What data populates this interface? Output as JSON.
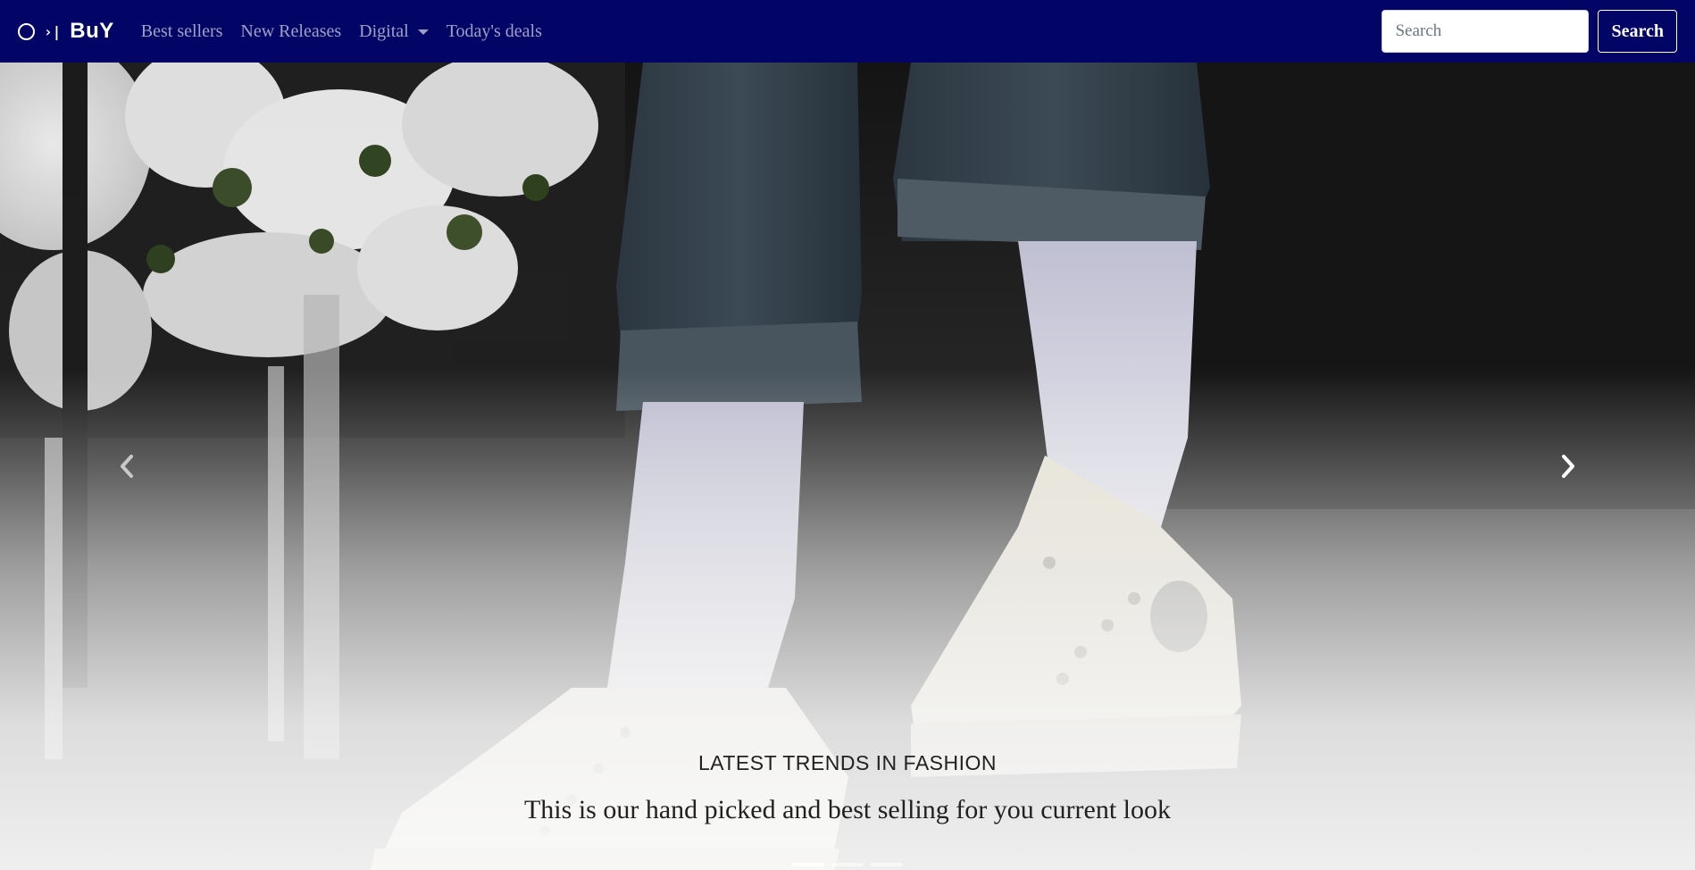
{
  "navbar": {
    "brand": "BuY",
    "brand_glyph": "›|",
    "links": {
      "best_sellers": "Best sellers",
      "new_releases": "New Releases",
      "digital": "Digital",
      "todays_deals": "Today's deals"
    },
    "search": {
      "placeholder": "Search",
      "value": "",
      "button_label": "Search"
    },
    "background_color": "#020466"
  },
  "carousel": {
    "slide_title": "LATEST TRENDS IN FASHION",
    "slide_text": "This is our hand picked and best selling for you current look",
    "prev_icon": "chevron-left-icon",
    "next_icon": "chevron-right-icon",
    "indicator_count": 3,
    "active_indicator": 1
  }
}
